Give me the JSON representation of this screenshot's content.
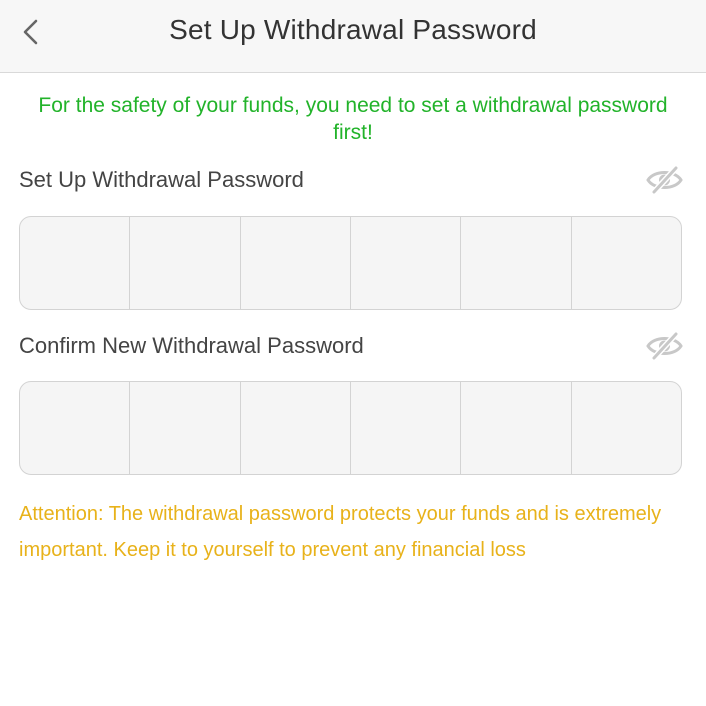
{
  "header": {
    "title": "Set Up Withdrawal Password",
    "back_icon": "chevron-left-icon"
  },
  "notice": "For the safety of your funds, you need to set a withdrawal password first!",
  "fields": [
    {
      "label": "Set Up Withdrawal Password",
      "visibility_icon": "eye-off-icon",
      "length": 6
    },
    {
      "label": "Confirm New Withdrawal Password",
      "visibility_icon": "eye-off-icon",
      "length": 6
    }
  ],
  "attention": "Attention: The withdrawal password protects your funds and is extremely important. Keep it to yourself to prevent any financial loss",
  "colors": {
    "notice": "#22b32a",
    "attention": "#e8b21a",
    "header_bg": "#f7f7f7",
    "cell_bg": "#f5f5f5"
  }
}
